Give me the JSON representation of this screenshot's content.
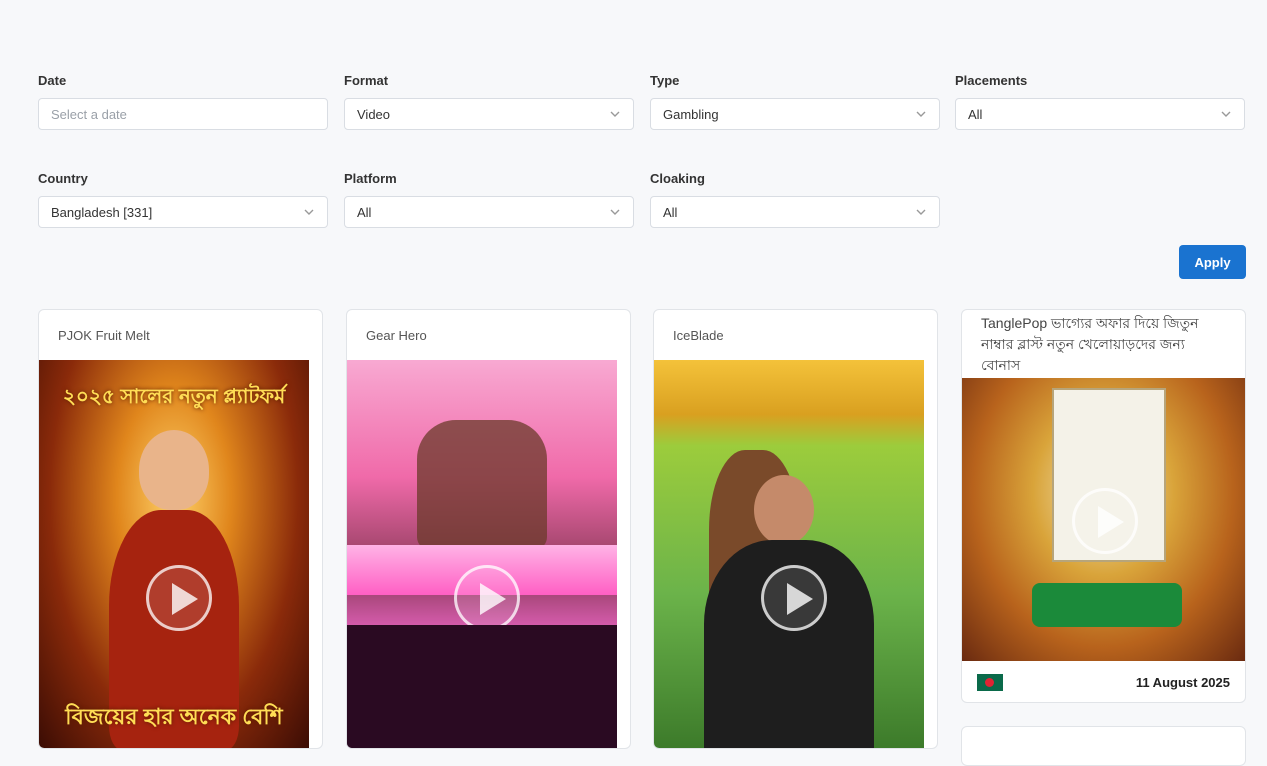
{
  "filters": {
    "date": {
      "label": "Date",
      "placeholder": "Select a date"
    },
    "format": {
      "label": "Format",
      "value": "Video"
    },
    "type": {
      "label": "Type",
      "value": "Gambling"
    },
    "placements": {
      "label": "Placements",
      "value": "All"
    },
    "country": {
      "label": "Country",
      "value": "Bangladesh [331]"
    },
    "platform": {
      "label": "Platform",
      "value": "All"
    },
    "cloaking": {
      "label": "Cloaking",
      "value": "All"
    },
    "apply_label": "Apply"
  },
  "cards": [
    {
      "title": "PJOK Fruit Melt",
      "overlay_top": "২০২৫ সালের নতুন প্ল্যাটফর্ম",
      "overlay_bottom": "বিজয়ের হার অনেক বেশি"
    },
    {
      "title": "Gear Hero"
    },
    {
      "title": "IceBlade"
    },
    {
      "title": "TanglePop ভাগ্যের অফার দিয়ে জিতুন নাম্বার ব্লাস্ট নতুন খেলোয়াড়দের জন্য বোনাস",
      "date": "11 August 2025",
      "flag_icon": "bangladesh-flag-icon"
    }
  ],
  "colors": {
    "accent": "#1a73d0",
    "background": "#f7f8fa"
  }
}
